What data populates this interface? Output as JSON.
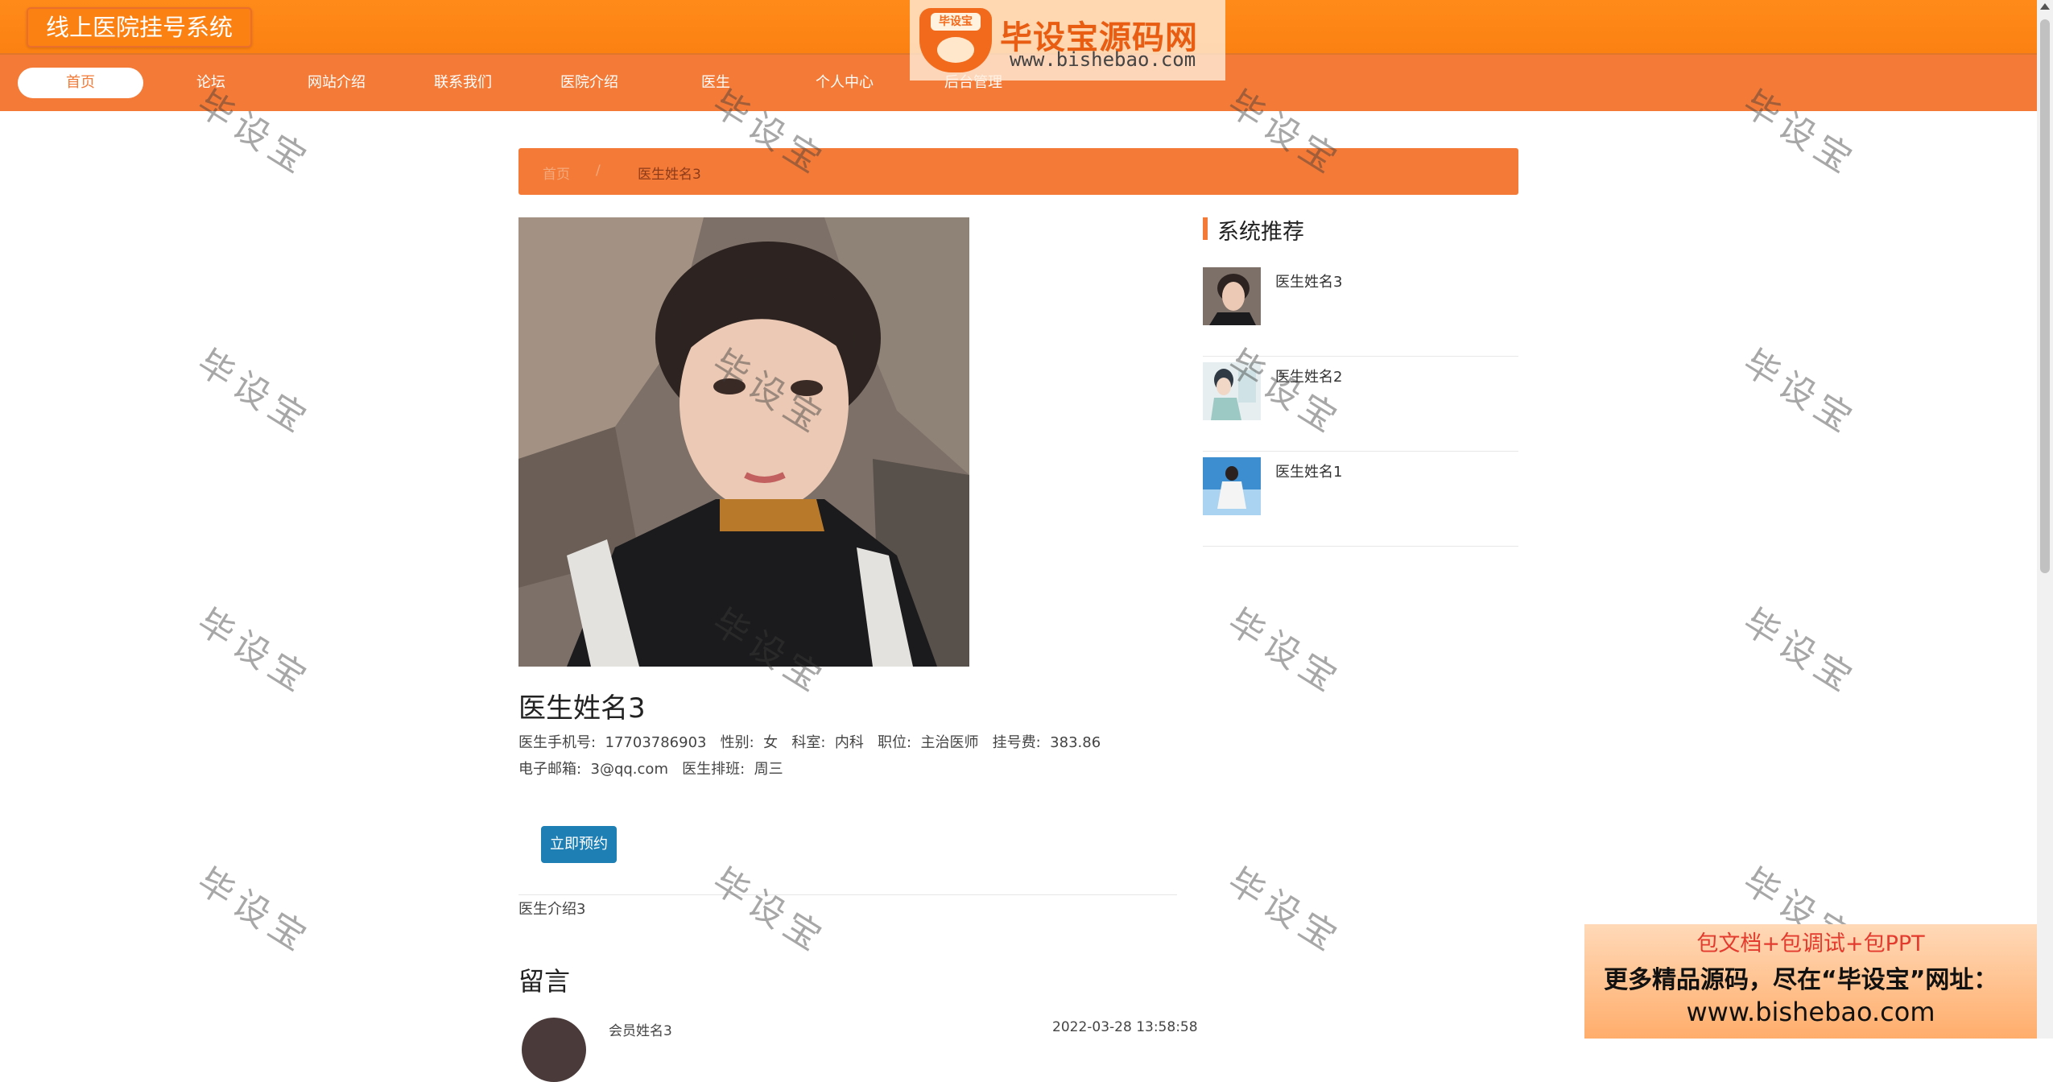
{
  "header": {
    "system_title": "线上医院挂号系统",
    "nav": [
      "首页",
      "论坛",
      "网站介绍",
      "联系我们",
      "医院介绍",
      "医生",
      "个人中心",
      "后台管理"
    ],
    "active_nav": "首页"
  },
  "logo": {
    "badge": "毕设宝",
    "text": "毕设宝源码网",
    "url": "www.bishebao.com"
  },
  "breadcrumb": {
    "home": "首页",
    "separator": "/",
    "current": "医生姓名3"
  },
  "doctor": {
    "name": "医生姓名3",
    "line1": "医生手机号:  17703786903   性别:  女   科室:  内科   职位:  主治医师   挂号费:  383.86",
    "line2": "电子邮箱:  3@qq.com   医生排班:  周三",
    "book_button": "立即预约",
    "intro": "医生介绍3"
  },
  "messages": {
    "title": "留言",
    "items": [
      {
        "user": "会员姓名3",
        "time": "2022-03-28 13:58:58"
      }
    ]
  },
  "recommend": {
    "title": "系统推荐",
    "items": [
      {
        "name": "医生姓名3"
      },
      {
        "name": "医生姓名2"
      },
      {
        "name": "医生姓名1"
      }
    ]
  },
  "watermark": "毕设宝",
  "ad": {
    "line1": "包文档+包调试+包PPT",
    "line2": "更多精品源码，尽在“毕设宝”网址：",
    "line3": "www.bishebao.com"
  },
  "colors": {
    "header_orange": "#fb8112",
    "nav_orange": "#f47a37",
    "button_blue": "#1e7fb5"
  }
}
